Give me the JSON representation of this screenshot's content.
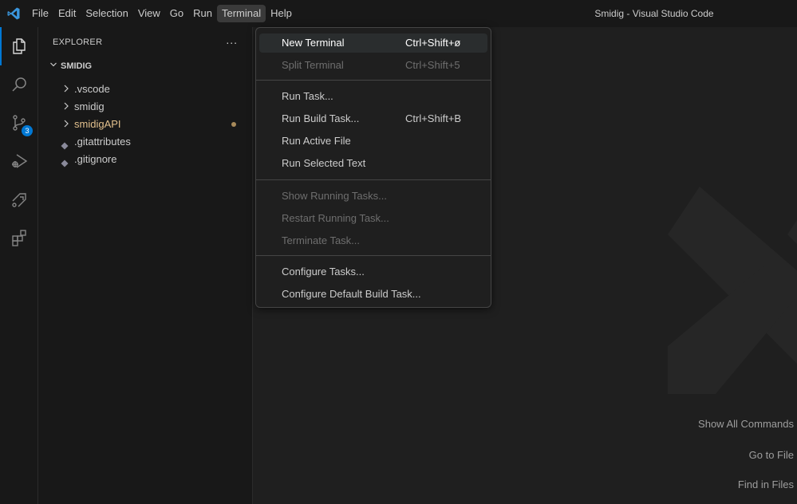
{
  "titlebar": {
    "menu": [
      "File",
      "Edit",
      "Selection",
      "View",
      "Go",
      "Run",
      "Terminal",
      "Help"
    ],
    "active_menu": "Terminal",
    "window_title": "Smidig - Visual Studio Code"
  },
  "activitybar": {
    "icons": [
      "explorer-icon",
      "search-icon",
      "source-control-icon",
      "run-debug-icon",
      "remote-explorer-icon",
      "extensions-icon"
    ],
    "source_control_badge": "3"
  },
  "sidebar": {
    "header": "EXPLORER",
    "more_actions": "...",
    "folder": "SMIDIG",
    "items": [
      {
        "label": ".vscode",
        "type": "folder"
      },
      {
        "label": "smidig",
        "type": "folder"
      },
      {
        "label": "smidigAPI",
        "type": "folder",
        "modified": true
      },
      {
        "label": ".gitattributes",
        "type": "file"
      },
      {
        "label": ".gitignore",
        "type": "file"
      }
    ]
  },
  "terminal_menu": {
    "items": [
      {
        "label": "New Terminal",
        "shortcut": "Ctrl+Shift+ø",
        "state": "highlighted"
      },
      {
        "label": "Split Terminal",
        "shortcut": "Ctrl+Shift+5",
        "state": "disabled"
      },
      {
        "label": "Run Task...",
        "shortcut": "",
        "state": "enabled"
      },
      {
        "label": "Run Build Task...",
        "shortcut": "Ctrl+Shift+B",
        "state": "enabled"
      },
      {
        "label": "Run Active File",
        "shortcut": "",
        "state": "enabled"
      },
      {
        "label": "Run Selected Text",
        "shortcut": "",
        "state": "enabled"
      },
      {
        "label": "Show Running Tasks...",
        "shortcut": "",
        "state": "disabled"
      },
      {
        "label": "Restart Running Task...",
        "shortcut": "",
        "state": "disabled"
      },
      {
        "label": "Terminate Task...",
        "shortcut": "",
        "state": "disabled"
      },
      {
        "label": "Configure Tasks...",
        "shortcut": "",
        "state": "enabled"
      },
      {
        "label": "Configure Default Build Task...",
        "shortcut": "",
        "state": "enabled"
      }
    ]
  },
  "editor": {
    "hints": [
      "Show All Commands",
      "Go to File",
      "Find in Files"
    ]
  },
  "colors": {
    "accent": "#0078d4",
    "modified_text": "#e2c08d"
  }
}
